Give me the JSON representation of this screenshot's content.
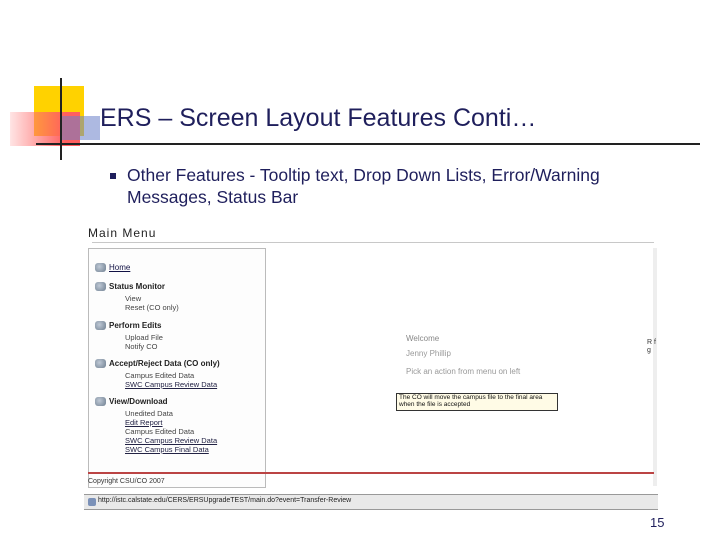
{
  "slide": {
    "title": "ERS – Screen Layout Features Conti…",
    "bullet": "Other Features - Tooltip text, Drop Down Lists, Error/Warning Messages, Status Bar",
    "page_number": "15"
  },
  "app": {
    "main_menu_title": "Main Menu",
    "menu": [
      {
        "label": "Home",
        "icon": "home-icon",
        "subs": []
      },
      {
        "label": "Status Monitor",
        "icon": "monitor-icon",
        "subs": [
          "View",
          "Reset (CO only)"
        ]
      },
      {
        "label": "Perform Edits",
        "icon": "edit-icon",
        "subs": [
          "Upload File",
          "Notify CO"
        ]
      },
      {
        "label": "Accept/Reject Data (CO only)",
        "icon": "accept-icon",
        "subs": [
          "Campus Edited Data",
          "SWC Campus Review Data"
        ]
      },
      {
        "label": "View/Download",
        "icon": "download-icon",
        "subs": [
          "Unedited Data",
          "Edit Report",
          "Campus Edited Data",
          "SWC Campus Review Data",
          "SWC Campus Final Data"
        ]
      }
    ],
    "welcome": "Welcome",
    "welcome_name": "Jenny Phillip",
    "welcome_hint": "Pick an action from menu on left",
    "tooltip": "The CO will move the campus file to the final area when the file is accepted",
    "edge_text": "R f g",
    "copyright": "Copyright CSU/CO 2007",
    "status_url": "http://istc.calstate.edu/CERS/ERSUpgradeTEST/main.do?event=Transfer-Review"
  }
}
